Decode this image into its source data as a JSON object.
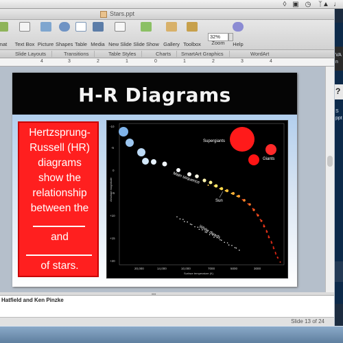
{
  "menubar": {
    "status_icons": [
      "dropbox-icon",
      "screen-icon",
      "clock-icon",
      "bluetooth-icon",
      "wifi-icon",
      "volume-icon"
    ]
  },
  "window": {
    "title": "Stars.ppt"
  },
  "toolbar": {
    "items": [
      "Format",
      "Text Box",
      "Picture",
      "Shapes",
      "Table",
      "Media",
      "New Slide",
      "Slide Show",
      "Gallery",
      "Toolbox"
    ],
    "first_item_visible": "mat",
    "zoom_value": "32%",
    "zoom_label": "Zoom",
    "help_label": "Help"
  },
  "ribbon": {
    "tabs": [
      "Slide Layouts",
      "Transitions",
      "Table Styles",
      "Charts",
      "SmartArt Graphics",
      "WordArt"
    ]
  },
  "ruler": {
    "numbers": [
      "4",
      "3",
      "2",
      "1",
      "0",
      "1",
      "2",
      "3",
      "4"
    ]
  },
  "slide": {
    "title": "H-R Diagrams",
    "text_lines": [
      "Hertzsprung-",
      "Russell (HR)",
      "diagrams",
      "show the",
      "relationship",
      "between the",
      "and",
      "of stars."
    ],
    "hr_diagram": {
      "y_ticks": [
        "-10",
        "-5",
        "0",
        "+5",
        "+10",
        "+15",
        "+20"
      ],
      "y_label": "Absolute magnitude",
      "x_ticks": [
        "20,000",
        "14,000",
        "10,000",
        "7000",
        "5000",
        "3000"
      ],
      "x_label": "Surface temperature (K)",
      "labels": {
        "supergiants": "Supergiants",
        "giants": "Giants",
        "main_sequence": "Main sequence",
        "sun": "Sun",
        "white_dwarfs": "White dwarfs"
      }
    }
  },
  "notes": {
    "text": "Hatfield and Ken Pinzke"
  },
  "status": {
    "slide_indicator": "Slide 13 of 24"
  },
  "edge_window": {
    "texts": [
      "VA",
      "n",
      "?",
      "S",
      "ppt"
    ]
  }
}
